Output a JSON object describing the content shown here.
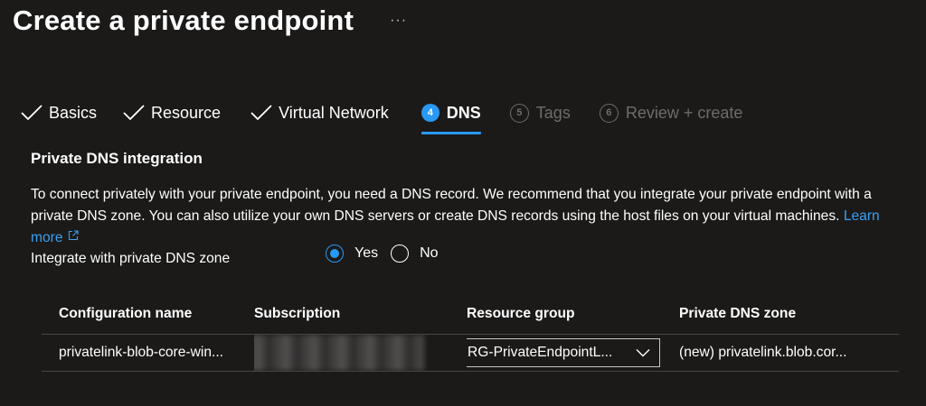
{
  "header": {
    "title": "Create a private endpoint",
    "more_label": "···"
  },
  "tabs": [
    {
      "label": "Basics",
      "state": "completed"
    },
    {
      "label": "Resource",
      "state": "completed"
    },
    {
      "label": "Virtual Network",
      "state": "completed"
    },
    {
      "number": "4",
      "label": "DNS",
      "state": "active"
    },
    {
      "number": "5",
      "label": "Tags",
      "state": "disabled"
    },
    {
      "number": "6",
      "label": "Review + create",
      "state": "disabled"
    }
  ],
  "dns": {
    "section_title": "Private DNS integration",
    "description": "To connect privately with your private endpoint, you need a DNS record. We recommend that you integrate your private endpoint with a private DNS zone. You can also utilize your own DNS servers or create DNS records using the host files on your virtual machines.",
    "learn_more": "Learn more",
    "integrate_label": "Integrate with private DNS zone",
    "options": {
      "yes": "Yes",
      "no": "No"
    },
    "selected": "yes"
  },
  "table": {
    "headers": [
      "Configuration name",
      "Subscription",
      "Resource group",
      "Private DNS zone"
    ],
    "rows": [
      {
        "configuration_name": "privatelink-blob-core-win...",
        "resource_group": "RG-PrivateEndpointL...",
        "private_dns_zone": "(new) privatelink.blob.cor..."
      }
    ]
  },
  "colors": {
    "background": "#1b1a19",
    "accent": "#2899f5",
    "link": "#3aa0f3",
    "disabled": "#6e6c6b"
  },
  "icons": {
    "completed_tab": "checkmark-icon",
    "more": "ellipsis-icon",
    "external": "external-link-icon",
    "dropdown": "chevron-down-icon"
  }
}
